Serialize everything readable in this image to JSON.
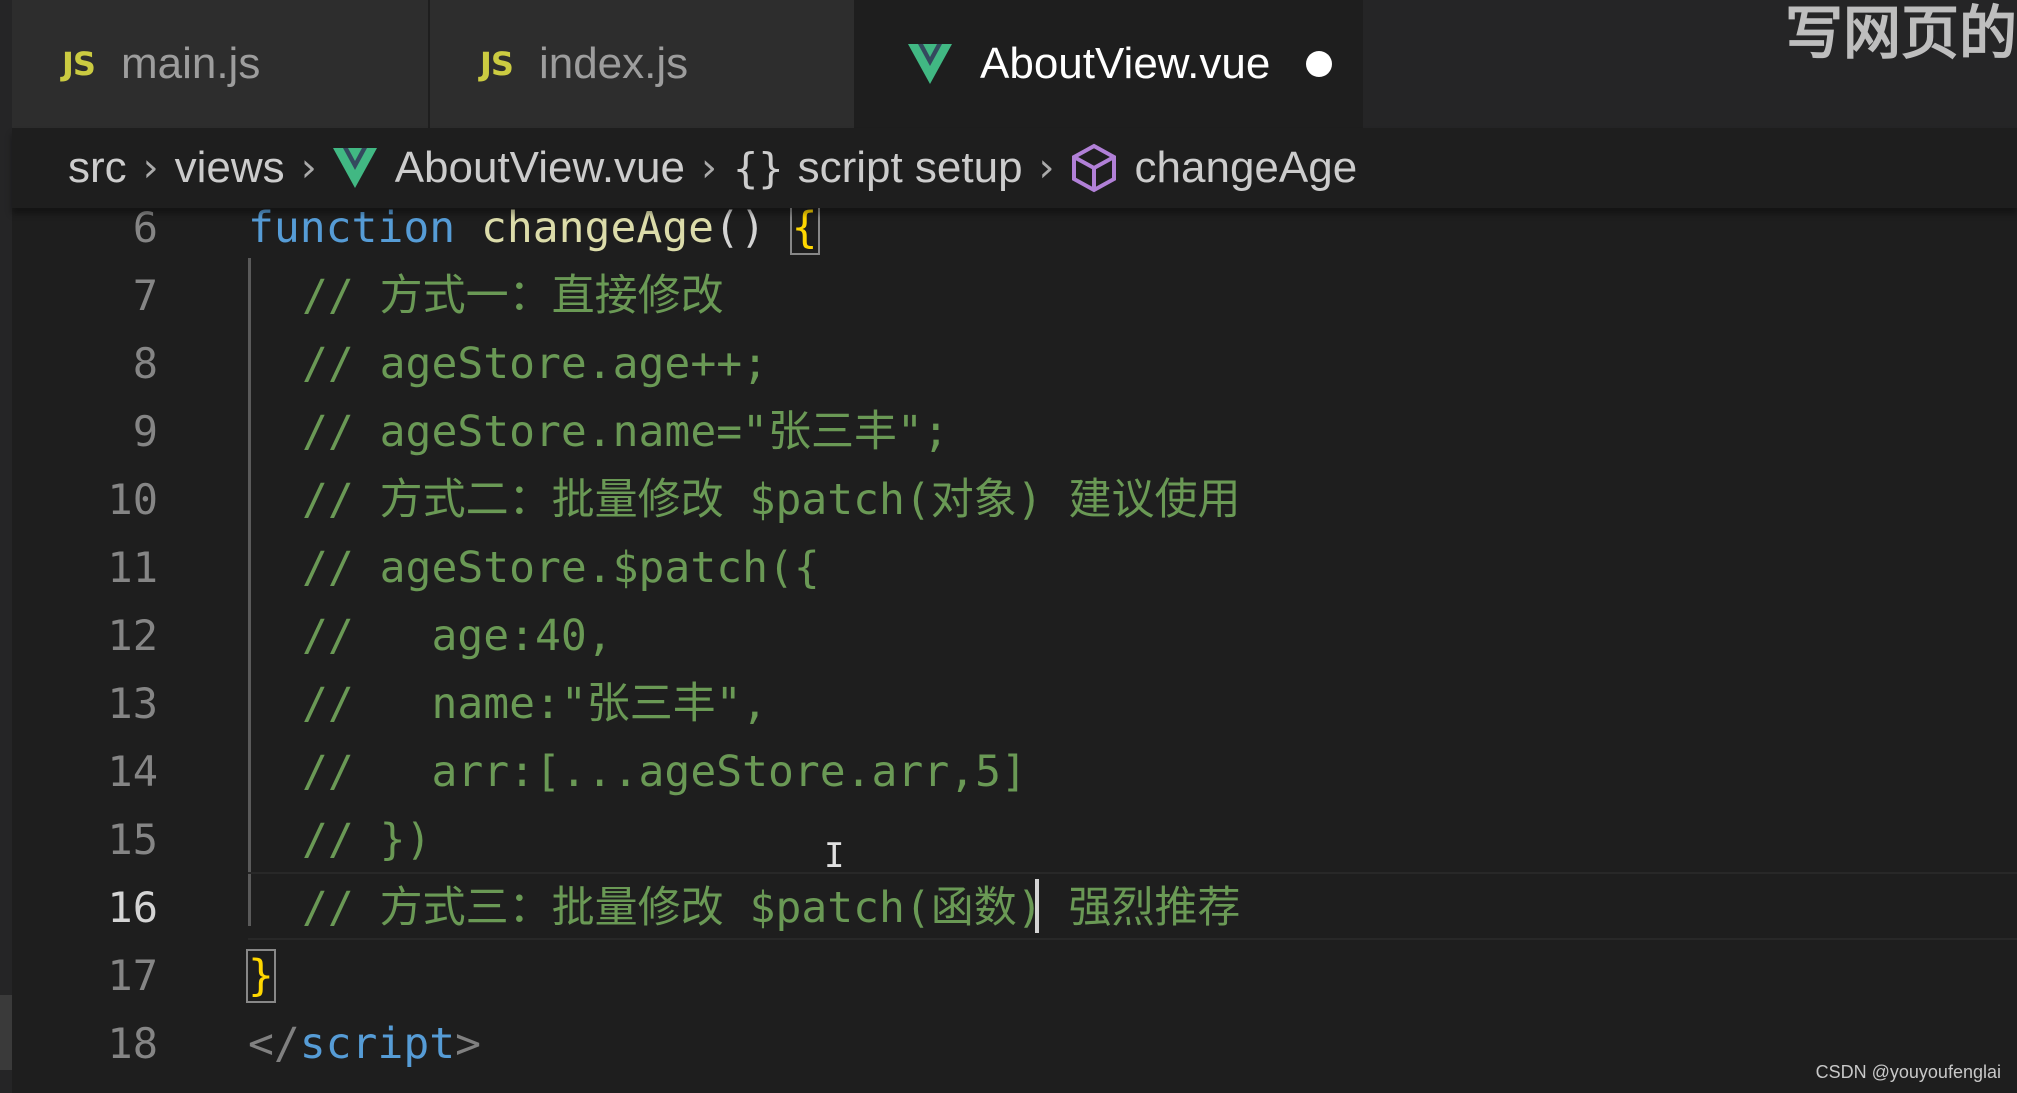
{
  "tabs": [
    {
      "icon": "JS",
      "label": "main.js"
    },
    {
      "icon": "JS",
      "label": "index.js"
    },
    {
      "icon": "vue-icon",
      "label": "AboutView.vue",
      "dirty": true
    }
  ],
  "watermark": "写网页的",
  "breadcrumb": {
    "items": [
      "src",
      "views",
      "AboutView.vue",
      "script setup",
      "changeAge"
    ],
    "braces_icon": "{}"
  },
  "editor": {
    "current_line": 16,
    "lines": [
      {
        "n": "6",
        "tokens": [
          [
            "kw",
            "function"
          ],
          [
            "punc",
            " "
          ],
          [
            "fn",
            "changeAge"
          ],
          [
            "punc",
            "() "
          ],
          [
            "brace-hl",
            "{"
          ]
        ]
      },
      {
        "n": "7",
        "tokens": [
          [
            "cm",
            "// 方式一：直接修改"
          ]
        ]
      },
      {
        "n": "8",
        "tokens": [
          [
            "cm",
            "// ageStore.age++;"
          ]
        ]
      },
      {
        "n": "9",
        "tokens": [
          [
            "cm",
            "// ageStore.name=\"张三丰\";"
          ]
        ]
      },
      {
        "n": "10",
        "tokens": [
          [
            "cm",
            "// 方式二：批量修改 $patch(对象) 建议使用"
          ]
        ]
      },
      {
        "n": "11",
        "tokens": [
          [
            "cm",
            "// ageStore.$patch({"
          ]
        ]
      },
      {
        "n": "12",
        "tokens": [
          [
            "cm",
            "//   age:40,"
          ]
        ]
      },
      {
        "n": "13",
        "tokens": [
          [
            "cm",
            "//   name:\"张三丰\","
          ]
        ]
      },
      {
        "n": "14",
        "tokens": [
          [
            "cm",
            "//   arr:[...ageStore.arr,5]"
          ]
        ]
      },
      {
        "n": "15",
        "tokens": [
          [
            "cm",
            "// })"
          ]
        ]
      },
      {
        "n": "16",
        "tokens": [
          [
            "cm",
            "// 方式三：批量修改 $patch(函数) 强烈推荐"
          ]
        ]
      },
      {
        "n": "17",
        "tokens": [
          [
            "brace-hl",
            "}"
          ]
        ]
      },
      {
        "n": "18",
        "tokens": [
          [
            "tag",
            "</"
          ],
          [
            "tagname",
            "script"
          ],
          [
            "tag",
            ">"
          ]
        ]
      }
    ]
  },
  "credit": "CSDN @youyoufenglai",
  "colors": {
    "keyword": "#569cd6",
    "function": "#dcdcaa",
    "comment": "#6a9955",
    "js_icon": "#cbcb41",
    "vue_green": "#41b883",
    "cube": "#b180d7"
  }
}
